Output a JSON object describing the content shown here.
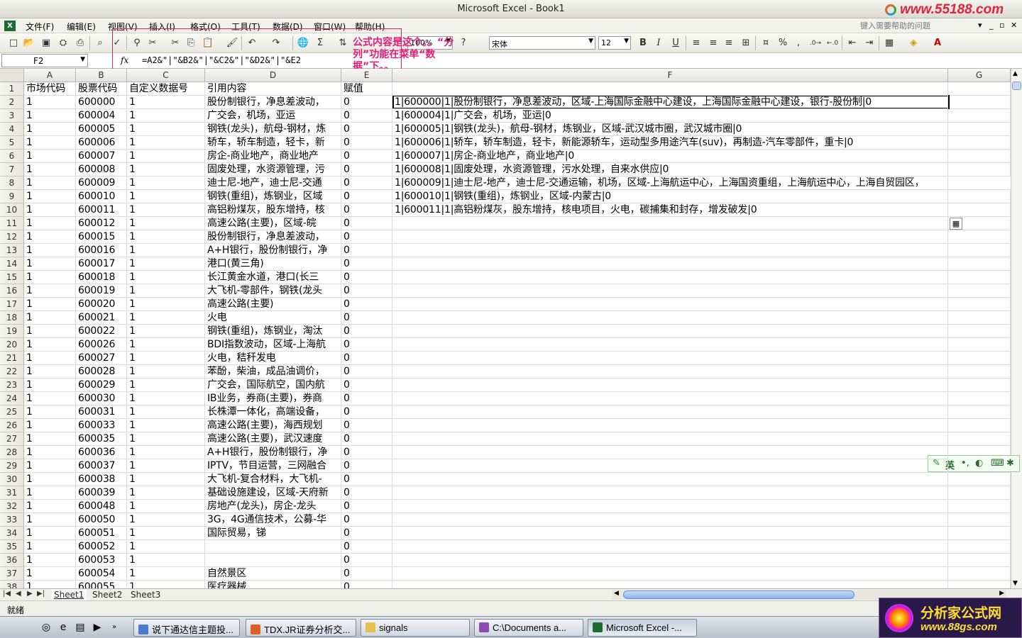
{
  "window": {
    "title": "Microsoft Excel - Book1",
    "watermark": "www.55188.com"
  },
  "menu": {
    "items": [
      "文件(F)",
      "编辑(E)",
      "视图(V)",
      "插入(I)",
      "格式(O)",
      "工具(T)",
      "数据(D)",
      "窗口(W)",
      "帮助(H)"
    ],
    "help_placeholder": "键入需要帮助的问题"
  },
  "toolbar": {
    "zoom": "100%",
    "font": "宋体",
    "font_size": "12",
    "bold": "B",
    "italic": "I",
    "underline": "U",
    "percent": "%",
    "comma": ","
  },
  "formula_bar": {
    "cell_ref": "F2",
    "fx": "fx",
    "formula": "=A2&\"|\"&B2&\"|\"&C2&\"|\"&D2&\"|\"&E2"
  },
  "annotation": {
    "text": "公式内容是这个。。“分列”功能在菜单“数据”下。。"
  },
  "columns": [
    "A",
    "B",
    "C",
    "D",
    "E",
    "F",
    "G"
  ],
  "rows": [
    {
      "n": "1",
      "A": "市场代码",
      "B": "股票代码",
      "C": "自定义数据号",
      "D": "引用内容",
      "E": "赋值",
      "F": ""
    },
    {
      "n": "2",
      "A": "1",
      "B": "600000",
      "C": "1",
      "D": "股份制银行，净息差波动，",
      "E": "0",
      "F": "1|600000|1|股份制银行，净息差波动，区域-上海国际金融中心建设，上海国际金融中心建设，银行-股份制|0"
    },
    {
      "n": "3",
      "A": "1",
      "B": "600004",
      "C": "1",
      "D": "广交会，机场，亚运",
      "E": "0",
      "F": "1|600004|1|广交会，机场，亚运|0"
    },
    {
      "n": "4",
      "A": "1",
      "B": "600005",
      "C": "1",
      "D": "钢铁(龙头)，航母-钢材，炼",
      "E": "0",
      "F": "1|600005|1|钢铁(龙头)，航母-钢材，炼钢业，区域-武汉城市圈，武汉城市圈|0"
    },
    {
      "n": "5",
      "A": "1",
      "B": "600006",
      "C": "1",
      "D": "轿车，轿车制造，轻卡，新",
      "E": "0",
      "F": "1|600006|1|轿车，轿车制造，轻卡，新能源轿车，运动型多用途汽车(suv)，再制造-汽车零部件，重卡|0"
    },
    {
      "n": "6",
      "A": "1",
      "B": "600007",
      "C": "1",
      "D": "房企-商业地产，商业地产",
      "E": "0",
      "F": "1|600007|1|房企-商业地产，商业地产|0"
    },
    {
      "n": "7",
      "A": "1",
      "B": "600008",
      "C": "1",
      "D": "固废处理，水资源管理，污",
      "E": "0",
      "F": "1|600008|1|固废处理，水资源管理，污水处理，自来水供应|0"
    },
    {
      "n": "8",
      "A": "1",
      "B": "600009",
      "C": "1",
      "D": "迪士尼-地产，迪士尼-交通",
      "E": "0",
      "F": "1|600009|1|迪士尼-地产，迪士尼-交通运输，机场，区域-上海航运中心，上海国资重组，上海航运中心，上海自贸园区，"
    },
    {
      "n": "9",
      "A": "1",
      "B": "600010",
      "C": "1",
      "D": "钢铁(重组)，炼钢业，区域",
      "E": "0",
      "F": "1|600010|1|钢铁(重组)，炼钢业，区域-内蒙古|0"
    },
    {
      "n": "10",
      "A": "1",
      "B": "600011",
      "C": "1",
      "D": "高铝粉煤灰，股东增持，核",
      "E": "0",
      "F": "1|600011|1|高铝粉煤灰，股东增持，核电项目，火电，碳捕集和封存，增发破发|0"
    },
    {
      "n": "11",
      "A": "1",
      "B": "600012",
      "C": "1",
      "D": "高速公路(主要)，区域-皖",
      "E": "0",
      "F": ""
    },
    {
      "n": "12",
      "A": "1",
      "B": "600015",
      "C": "1",
      "D": "股份制银行，净息差波动，",
      "E": "0",
      "F": ""
    },
    {
      "n": "13",
      "A": "1",
      "B": "600016",
      "C": "1",
      "D": "A+H银行，股份制银行，净",
      "E": "0",
      "F": ""
    },
    {
      "n": "14",
      "A": "1",
      "B": "600017",
      "C": "1",
      "D": "港口(黄三角)",
      "E": "0",
      "F": ""
    },
    {
      "n": "15",
      "A": "1",
      "B": "600018",
      "C": "1",
      "D": "长江黄金水道，港口(长三",
      "E": "0",
      "F": ""
    },
    {
      "n": "16",
      "A": "1",
      "B": "600019",
      "C": "1",
      "D": "大飞机-零部件，钢铁(龙头",
      "E": "0",
      "F": ""
    },
    {
      "n": "17",
      "A": "1",
      "B": "600020",
      "C": "1",
      "D": "高速公路(主要)",
      "E": "0",
      "F": ""
    },
    {
      "n": "18",
      "A": "1",
      "B": "600021",
      "C": "1",
      "D": "火电",
      "E": "0",
      "F": ""
    },
    {
      "n": "19",
      "A": "1",
      "B": "600022",
      "C": "1",
      "D": "钢铁(重组)，炼钢业，淘汰",
      "E": "0",
      "F": ""
    },
    {
      "n": "20",
      "A": "1",
      "B": "600026",
      "C": "1",
      "D": "BDI指数波动，区域-上海航",
      "E": "0",
      "F": ""
    },
    {
      "n": "21",
      "A": "1",
      "B": "600027",
      "C": "1",
      "D": "火电，秸秆发电",
      "E": "0",
      "F": ""
    },
    {
      "n": "22",
      "A": "1",
      "B": "600028",
      "C": "1",
      "D": "苯酚，柴油，成品油调价，",
      "E": "0",
      "F": ""
    },
    {
      "n": "23",
      "A": "1",
      "B": "600029",
      "C": "1",
      "D": "广交会，国际航空，国内航",
      "E": "0",
      "F": ""
    },
    {
      "n": "24",
      "A": "1",
      "B": "600030",
      "C": "1",
      "D": "IB业务，券商(主要)，券商",
      "E": "0",
      "F": ""
    },
    {
      "n": "25",
      "A": "1",
      "B": "600031",
      "C": "1",
      "D": "长株潭一体化，高端设备，",
      "E": "0",
      "F": ""
    },
    {
      "n": "26",
      "A": "1",
      "B": "600033",
      "C": "1",
      "D": "高速公路(主要)，海西规划",
      "E": "0",
      "F": ""
    },
    {
      "n": "27",
      "A": "1",
      "B": "600035",
      "C": "1",
      "D": "高速公路(主要)，武汉速度",
      "E": "0",
      "F": ""
    },
    {
      "n": "28",
      "A": "1",
      "B": "600036",
      "C": "1",
      "D": "A+H银行，股份制银行，净",
      "E": "0",
      "F": ""
    },
    {
      "n": "29",
      "A": "1",
      "B": "600037",
      "C": "1",
      "D": "IPTV，节目运营，三网融合",
      "E": "0",
      "F": ""
    },
    {
      "n": "30",
      "A": "1",
      "B": "600038",
      "C": "1",
      "D": "大飞机-复合材料，大飞机-",
      "E": "0",
      "F": ""
    },
    {
      "n": "31",
      "A": "1",
      "B": "600039",
      "C": "1",
      "D": "基础设施建设，区域-天府新",
      "E": "0",
      "F": ""
    },
    {
      "n": "32",
      "A": "1",
      "B": "600048",
      "C": "1",
      "D": "房地产(龙头)，房企-龙头",
      "E": "0",
      "F": ""
    },
    {
      "n": "33",
      "A": "1",
      "B": "600050",
      "C": "1",
      "D": "3G，4G通信技术，公募-华",
      "E": "0",
      "F": ""
    },
    {
      "n": "34",
      "A": "1",
      "B": "600051",
      "C": "1",
      "D": "国际贸易，锑",
      "E": "0",
      "F": ""
    },
    {
      "n": "35",
      "A": "1",
      "B": "600052",
      "C": "1",
      "D": "",
      "E": "0",
      "F": ""
    },
    {
      "n": "36",
      "A": "1",
      "B": "600053",
      "C": "1",
      "D": "",
      "E": "0",
      "F": ""
    },
    {
      "n": "37",
      "A": "1",
      "B": "600054",
      "C": "1",
      "D": "自然景区",
      "E": "0",
      "F": ""
    },
    {
      "n": "38",
      "A": "1",
      "B": "600055",
      "C": "1",
      "D": "医疗器械",
      "E": "0",
      "F": ""
    }
  ],
  "sheets": [
    "Sheet1",
    "Sheet2",
    "Sheet3"
  ],
  "status": {
    "text": "就绪"
  },
  "ime": {
    "lang": "英"
  },
  "taskbar": {
    "tasks": [
      {
        "label": "说下通达信主题投..."
      },
      {
        "label": "TDX.JR证券分析交..."
      },
      {
        "label": "signals"
      },
      {
        "label": "C:\\Documents a..."
      },
      {
        "label": "Microsoft Excel -..."
      }
    ]
  },
  "logo": {
    "name": "分析家公式网",
    "url": "www.88gs.com"
  },
  "colors": {
    "accent_annotation": "#e0207a",
    "selection": "#000000",
    "scroll_thumb": "#8ab2ec"
  }
}
